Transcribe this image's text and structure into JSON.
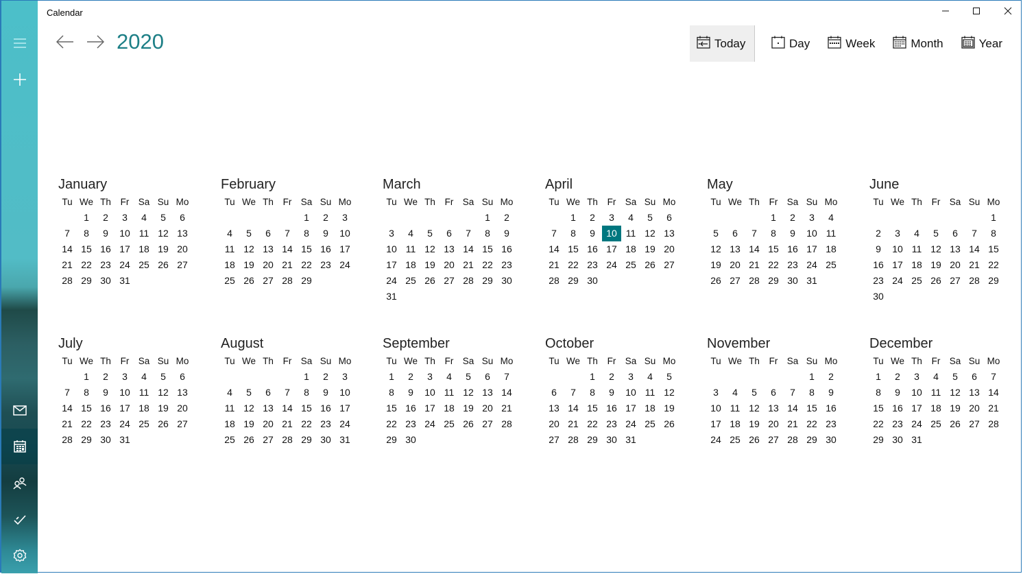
{
  "app": {
    "title": "Calendar"
  },
  "window_controls": {
    "minimize": "minimize-icon",
    "maximize": "maximize-icon",
    "close": "close-icon"
  },
  "rail": {
    "top_items": [
      {
        "name": "menu",
        "icon": "hamburger-icon"
      },
      {
        "name": "new-event",
        "icon": "plus-icon"
      }
    ],
    "bottom_items": [
      {
        "name": "mail",
        "icon": "mail-icon"
      },
      {
        "name": "calendar",
        "icon": "calendar-icon",
        "selected": true
      },
      {
        "name": "people",
        "icon": "people-icon"
      },
      {
        "name": "todo",
        "icon": "checkmark-icon"
      },
      {
        "name": "settings",
        "icon": "gear-icon"
      }
    ]
  },
  "header": {
    "year": "2020",
    "prev_icon": "arrow-left-icon",
    "next_icon": "arrow-right-icon"
  },
  "toolbar": {
    "today_label": "Today",
    "day_label": "Day",
    "week_label": "Week",
    "month_label": "Month",
    "year_label": "Year"
  },
  "calendar": {
    "weekday_headers": [
      "Tu",
      "We",
      "Th",
      "Fr",
      "Sa",
      "Su",
      "Mo"
    ],
    "today": {
      "month": 4,
      "day": 10
    },
    "accent_color": "#00777f",
    "months": [
      {
        "name": "January",
        "offset": 1,
        "days": 31
      },
      {
        "name": "February",
        "offset": 4,
        "days": 29
      },
      {
        "name": "March",
        "offset": 5,
        "days": 31
      },
      {
        "name": "April",
        "offset": 1,
        "days": 30
      },
      {
        "name": "May",
        "offset": 3,
        "days": 31
      },
      {
        "name": "June",
        "offset": 6,
        "days": 30
      },
      {
        "name": "July",
        "offset": 1,
        "days": 31
      },
      {
        "name": "August",
        "offset": 4,
        "days": 31
      },
      {
        "name": "September",
        "offset": 0,
        "days": 30
      },
      {
        "name": "October",
        "offset": 2,
        "days": 31
      },
      {
        "name": "November",
        "offset": 5,
        "days": 30
      },
      {
        "name": "December",
        "offset": 0,
        "days": 31
      }
    ]
  }
}
